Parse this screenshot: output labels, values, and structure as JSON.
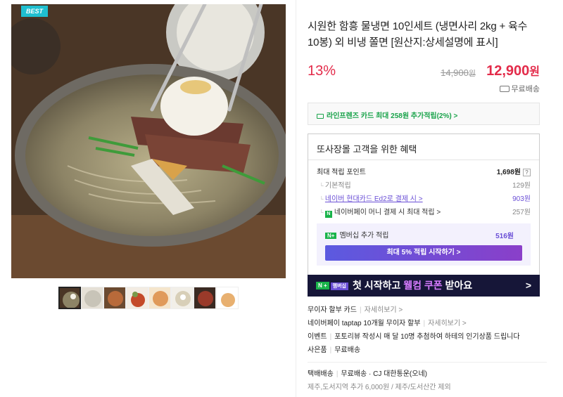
{
  "badge": "BEST",
  "product": {
    "title": "시원한 함흥 물냉면 10인세트 (냉면사리 2kg + 육수 10봉) 외 비냉 쫄면 [원산지:상세설명에 표시]",
    "discount": "13%",
    "original_price": "14,900",
    "original_unit": "원",
    "sale_price": "12,900",
    "sale_unit": "원",
    "shipping": "무료배송"
  },
  "card_promo": "라인프렌즈 카드 최대 258원 추가적립(2%) >",
  "benefit": {
    "header": "또사장몰 고객을 위한 혜택",
    "max_points_label": "최대 적립 포인트",
    "max_points_value": "1,698원",
    "help": "?",
    "rows": [
      {
        "label": "기본적립",
        "value": "129원"
      },
      {
        "label": "네이버 현대카드 Ed2로 결제 시 >",
        "value": "903원"
      },
      {
        "label": "네이버페이 머니 결제 시 최대 적립 >",
        "value": "257원",
        "npay": "N"
      }
    ],
    "membership_badge": "N+",
    "membership_label": "멤버십 추가 적립",
    "membership_value": "516원",
    "start_button": "최대 5% 적립 시작하기 >"
  },
  "banner": {
    "badge1": "N +",
    "badge2": "멤버십",
    "text_before": "첫 시작하고 ",
    "text_highlight": "웰컴 쿠폰",
    "text_after": " 받아요",
    "arrow": ">"
  },
  "info": {
    "line1_label": "무이자 할부 카드",
    "line1_more": "자세히보기 >",
    "line2_label": "네이버페이 taptap 10개월 무이자 할부",
    "line2_more": "자세히보기 >",
    "line3_label": "이벤트",
    "line3_text": "포토리뷰 작성시 매 달 10명 추첨하여 하테의 인기상품 드립니다",
    "line4_label": "사은품",
    "line4_text": "무료배송",
    "delivery_label": "택배배송",
    "delivery_text": "무료배송 · CJ 대한통운(오네)",
    "delivery_note": "제주,도서지역 추가 6,000원 / 제주/도서산간 제외"
  },
  "colors": {
    "accent_red": "#e32b4a",
    "naver_green": "#19b34a",
    "purple": "#6a4fd6",
    "banner_bg": "#161638"
  }
}
